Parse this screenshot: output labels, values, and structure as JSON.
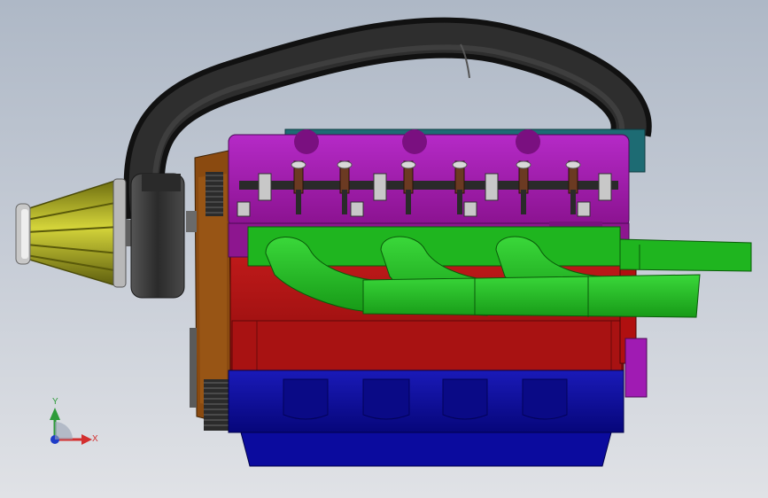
{
  "viewport": {
    "model": "engine-assembly",
    "view_orientation": "front-view"
  },
  "triad": {
    "x_label": "X",
    "y_label": "Y",
    "x_color": "#d32f2f",
    "y_color": "#2e9b3a",
    "z_color": "#1f3cc7"
  },
  "colors": {
    "background_top": "#aeb8c6",
    "background_bottom": "#e0e2e6",
    "hose": "#1c1c1c",
    "valve_cover": "#a01bb3",
    "head_plate": "#1d6b73",
    "manifold": "#1fb51f",
    "engine_block": "#b01010",
    "oil_pan": "#0b0b9e",
    "timing_cover": "#8a4a10",
    "air_filter": "#9a9a18",
    "pulley_grey": "#3a3a3a"
  }
}
